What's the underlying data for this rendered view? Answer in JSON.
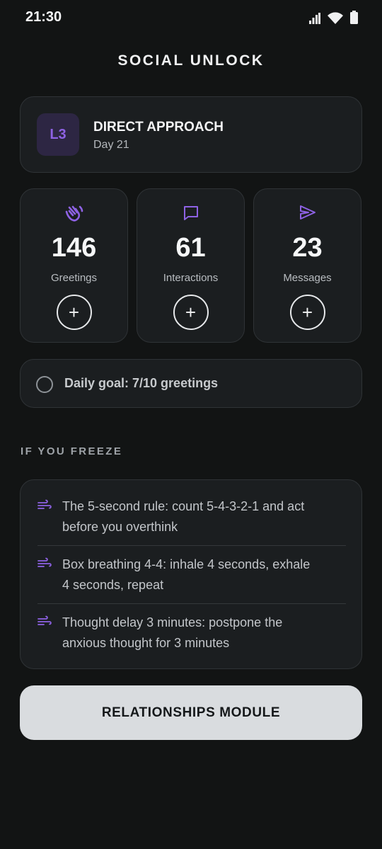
{
  "status_bar": {
    "time": "21:30"
  },
  "app": {
    "title": "SOCIAL UNLOCK"
  },
  "level": {
    "badge": "L3",
    "name": "DIRECT APPROACH",
    "day": "Day 21"
  },
  "stats": [
    {
      "icon": "waving-hand-icon",
      "value": "146",
      "label": "Greetings",
      "add_symbol": "+"
    },
    {
      "icon": "chat-bubble-icon",
      "value": "61",
      "label": "Interactions",
      "add_symbol": "+"
    },
    {
      "icon": "send-icon",
      "value": "23",
      "label": "Messages",
      "add_symbol": "+"
    }
  ],
  "daily_goal": {
    "text": "Daily goal: 7/10 greetings",
    "checked": false
  },
  "freeze_section": {
    "header": "IF YOU FREEZE",
    "tips": [
      {
        "icon": "wind-icon",
        "line1": "The 5-second rule: count 5-4-3-2-1 and act",
        "line2": "before you overthink"
      },
      {
        "icon": "wind-icon",
        "line1": "Box breathing 4-4: inhale 4 seconds, exhale",
        "line2": "4 seconds, repeat"
      },
      {
        "icon": "wind-icon",
        "line1": "Thought delay 3 minutes: postpone the",
        "line2": "anxious thought for 3 minutes"
      }
    ]
  },
  "module_button": {
    "label": "RELATIONSHIPS MODULE"
  },
  "colors": {
    "background": "#121414",
    "card": "#1b1e20",
    "accent": "#8e62e4",
    "button": "#d9dcdf"
  }
}
